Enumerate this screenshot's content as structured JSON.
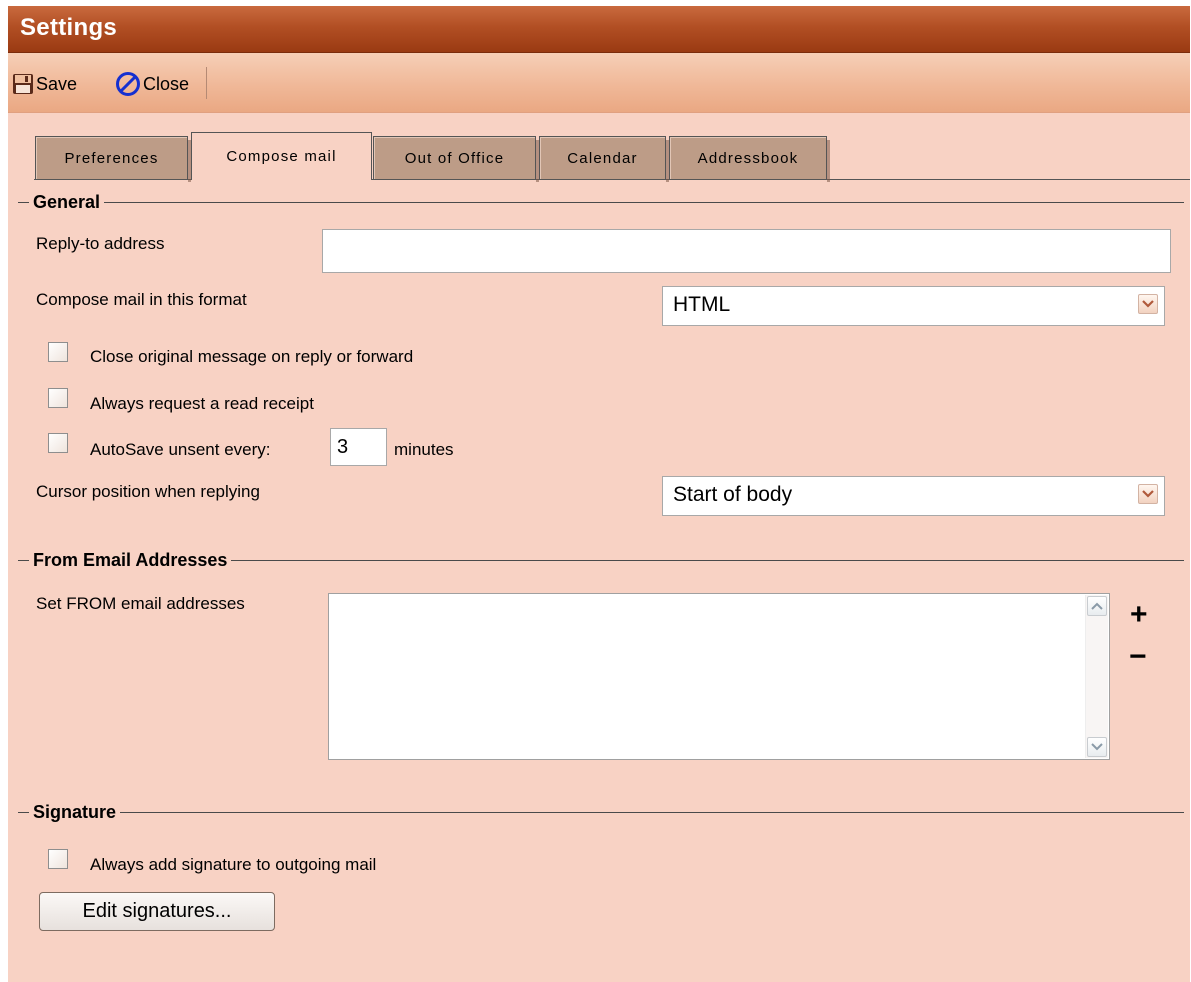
{
  "window": {
    "title": "Settings"
  },
  "toolbar": {
    "save_label": "Save",
    "close_label": "Close"
  },
  "tabs": [
    {
      "label": "Preferences",
      "active": false
    },
    {
      "label": "Compose mail",
      "active": true
    },
    {
      "label": "Out of Office",
      "active": false
    },
    {
      "label": "Calendar",
      "active": false
    },
    {
      "label": "Addressbook",
      "active": false
    }
  ],
  "general": {
    "heading": "General",
    "reply_to_label": "Reply-to address",
    "reply_to_value": "",
    "format_label": "Compose mail in this format",
    "format_value": "HTML",
    "close_original_label": "Close original message on reply or forward",
    "read_receipt_label": "Always request a read receipt",
    "autosave_label": "AutoSave unsent every:",
    "autosave_value": "3",
    "autosave_unit": "minutes",
    "cursor_label": "Cursor position when replying",
    "cursor_value": "Start of body"
  },
  "from": {
    "heading": "From Email Addresses",
    "label": "Set FROM email addresses",
    "add_symbol": "+",
    "remove_symbol": "−"
  },
  "signature": {
    "heading": "Signature",
    "always_add_label": "Always add signature to outgoing mail",
    "edit_button": "Edit signatures..."
  },
  "icons": {
    "save": "floppy-disk-icon",
    "close": "no-entry-icon",
    "dropdown": "chevron-down-icon",
    "scroll_up": "chevron-up-icon",
    "scroll_down": "chevron-down-icon"
  },
  "colors": {
    "titlebar": "#b24f24",
    "toolbar": "#f0b898",
    "background": "#f8d2c4",
    "tab_inactive": "#bd9c87"
  }
}
